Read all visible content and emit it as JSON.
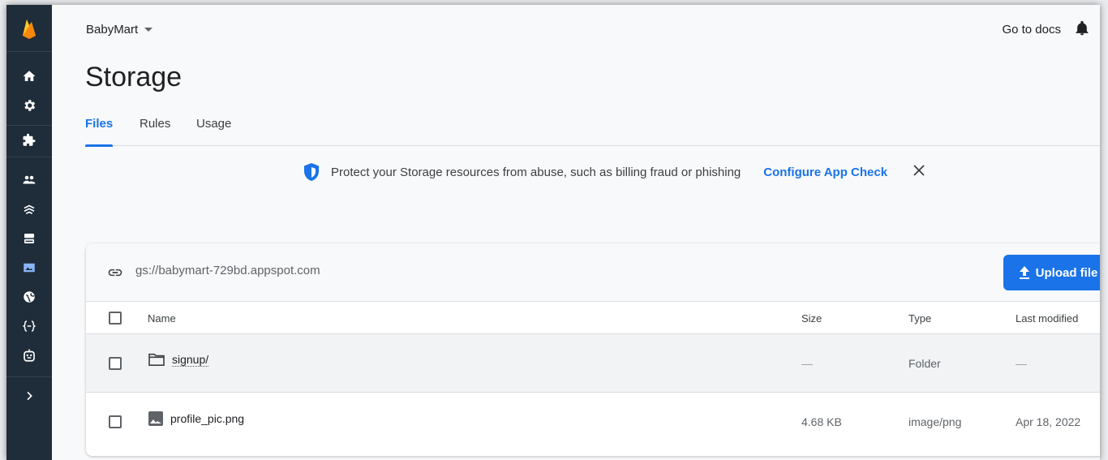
{
  "header": {
    "project_name": "BabyMart",
    "docs_link": "Go to docs"
  },
  "page": {
    "title": "Storage",
    "tabs": [
      {
        "label": "Files",
        "active": true
      },
      {
        "label": "Rules",
        "active": false
      },
      {
        "label": "Usage",
        "active": false
      }
    ]
  },
  "banner": {
    "message": "Protect your Storage resources from abuse, such as billing fraud or phishing",
    "action": "Configure App Check"
  },
  "bucket": {
    "path": "gs://babymart-729bd.appspot.com",
    "upload_label": "Upload file"
  },
  "table": {
    "columns": [
      "Name",
      "Size",
      "Type",
      "Last modified"
    ],
    "rows": [
      {
        "name": "signup/",
        "size": "—",
        "type": "Folder",
        "modified": "—",
        "icon": "folder-icon"
      },
      {
        "name": "profile_pic.png",
        "size": "4.68 KB",
        "type": "image/png",
        "modified": "Apr 18, 2022",
        "icon": "image-icon"
      }
    ]
  },
  "colors": {
    "sidebar_bg": "#1f2c3a",
    "accent": "#1a73e8",
    "logo": "#ffca28"
  }
}
